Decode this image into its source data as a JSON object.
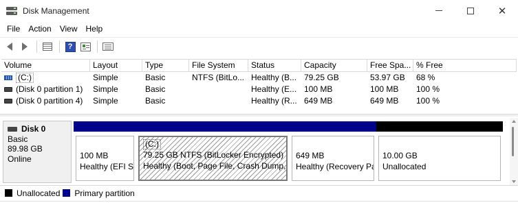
{
  "window": {
    "title": "Disk Management"
  },
  "menu": [
    "File",
    "Action",
    "View",
    "Help"
  ],
  "toolbar": {
    "icons": [
      "back-arrow-icon",
      "forward-arrow-icon",
      "disk-list-icon",
      "help-icon",
      "properties-icon",
      "volume-list-icon"
    ],
    "help_glyph": "?"
  },
  "volumes": {
    "columns": [
      "Volume",
      "Layout",
      "Type",
      "File System",
      "Status",
      "Capacity",
      "Free Spa...",
      "% Free"
    ],
    "rows": [
      {
        "volume": "(C:)",
        "layout": "Simple",
        "type": "Basic",
        "fs": "NTFS (BitLo...",
        "status": "Healthy (B...",
        "capacity": "79.25 GB",
        "free": "53.97 GB",
        "pct": "68 %",
        "icon": "system-drive-icon"
      },
      {
        "volume": "(Disk 0 partition 1)",
        "layout": "Simple",
        "type": "Basic",
        "fs": "",
        "status": "Healthy (E...",
        "capacity": "100 MB",
        "free": "100 MB",
        "pct": "100 %",
        "icon": "drive-icon"
      },
      {
        "volume": "(Disk 0 partition 4)",
        "layout": "Simple",
        "type": "Basic",
        "fs": "",
        "status": "Healthy (R...",
        "capacity": "649 MB",
        "free": "649 MB",
        "pct": "100 %",
        "icon": "drive-icon"
      }
    ]
  },
  "disk": {
    "name": "Disk 0",
    "type": "Basic",
    "size": "89.98 GB",
    "state": "Online",
    "partitions": [
      {
        "name": "",
        "size": "100 MB",
        "status": "Healthy (EFI System Partition)",
        "band_color": "#00008b"
      },
      {
        "name": "(C:)",
        "size": "79.25 GB NTFS (BitLocker Encrypted)",
        "status": "Healthy (Boot, Page File, Crash Dump, Basic Data Partition)",
        "band_color": "#00008b"
      },
      {
        "name": "",
        "size": "649 MB",
        "status": "Healthy (Recovery Partition)",
        "band_color": "#00008b"
      },
      {
        "name": "",
        "size": "10.00 GB",
        "status": "Unallocated",
        "band_color": "#000000"
      }
    ]
  },
  "legend": [
    {
      "label": "Unallocated",
      "color": "#000000"
    },
    {
      "label": "Primary partition",
      "color": "#00008b"
    }
  ]
}
